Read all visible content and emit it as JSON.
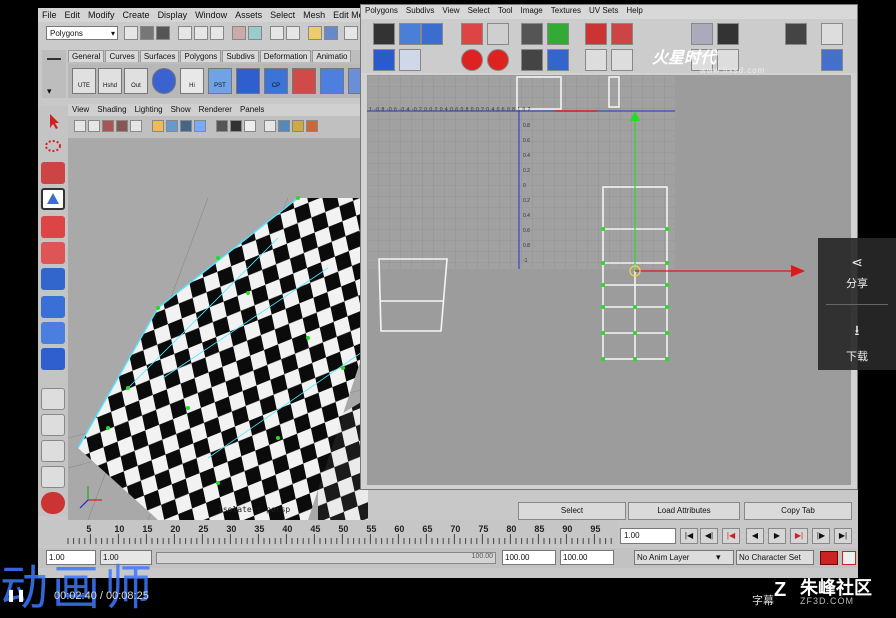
{
  "main_menu": [
    "File",
    "Edit",
    "Modify",
    "Create",
    "Display",
    "Window",
    "Assets",
    "Select",
    "Mesh",
    "Edit Me"
  ],
  "status_line": {
    "mode_value": "Polygons"
  },
  "shelf_tabs": [
    "General",
    "Curves",
    "Surfaces",
    "Polygons",
    "Subdivs",
    "Deformation",
    "Animatio"
  ],
  "shelf_buttons": [
    "UTE",
    "Hshd",
    "Out",
    "",
    "Hi",
    "PST",
    "",
    "CP"
  ],
  "viewport_menu": [
    "View",
    "Shading",
    "Lighting",
    "Show",
    "Renderer",
    "Panels"
  ],
  "viewport_hud": "Isolate : persp",
  "uv_menu": [
    "Polygons",
    "Subdivs",
    "View",
    "Select",
    "Tool",
    "Image",
    "Textures",
    "UV Sets",
    "Help"
  ],
  "uv_grid": {
    "top_labels": [
      "1",
      "-0.8",
      "-0.6",
      "-0.4",
      "-0.2",
      "0",
      "0.2",
      "0.4",
      "0.6",
      "0.8",
      "0",
      "0.2",
      "0.4",
      "0.6",
      "0.8",
      "1",
      "0.2"
    ],
    "side_labels": [
      "0.8",
      "0.6",
      "0.4",
      "0.2",
      "0",
      "0.2",
      "0.4",
      "0.6",
      "0.8",
      "-1"
    ]
  },
  "panel_buttons": {
    "select": "Select",
    "load_attributes": "Load Attributes",
    "copy_tab": "Copy Tab"
  },
  "timeline": {
    "ticks": [
      "5",
      "10",
      "15",
      "20",
      "25",
      "30",
      "35",
      "40",
      "45",
      "50",
      "55",
      "60",
      "65",
      "70",
      "75",
      "80",
      "85",
      "90",
      "95"
    ],
    "current_frame": "1.00"
  },
  "range": {
    "start": "1.00",
    "inner_start": "1.00",
    "inner_end": "100.00",
    "end_a": "100.00",
    "end_b": "100.00",
    "anim_layer": "No Anim Layer",
    "character_set": "No Character Set"
  },
  "share_panel": {
    "share": "分享",
    "download": "下载"
  },
  "overlay": {
    "watermark_left": "动画师",
    "time": "00:02:40 / 00:08:25",
    "cc_label": "字幕",
    "brand": "朱峰社区",
    "brand_sub": "ZF3D.COM",
    "top_logo": "火星时代",
    "top_logo_url": "www.hxsd.com"
  },
  "colors": {
    "accent_blue": "#3c78ff",
    "uv_green": "#22dd22",
    "uv_red": "#e01818",
    "axis_blue": "#2233cc"
  }
}
